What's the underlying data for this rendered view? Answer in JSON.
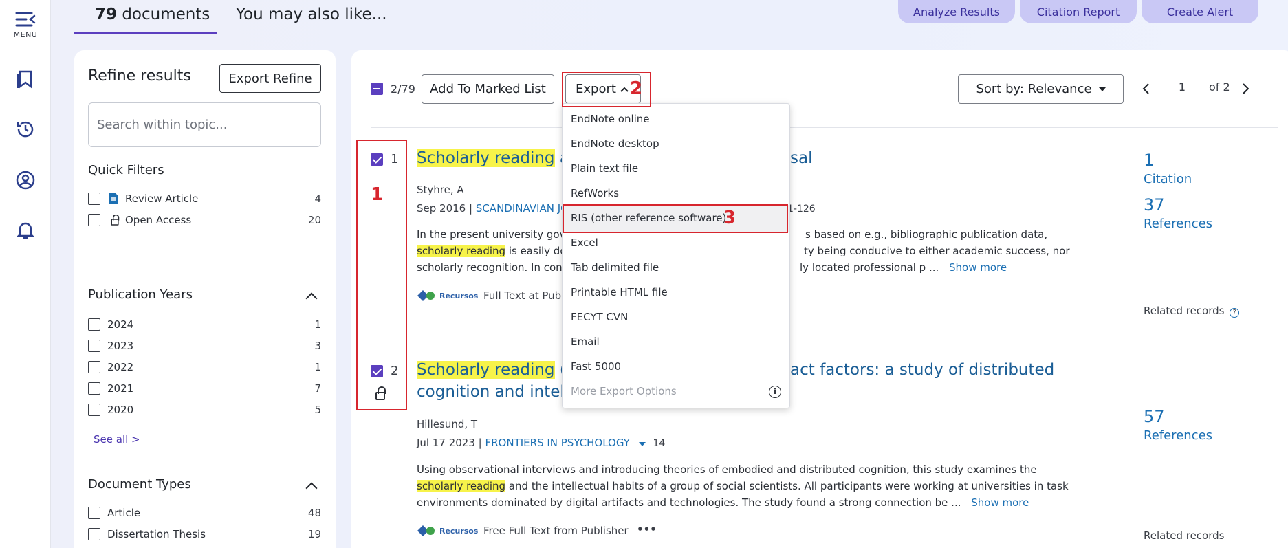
{
  "rail": {
    "menu_label": "MENU"
  },
  "tabs": {
    "count": "79",
    "documents": "documents",
    "also_like": "You may also like..."
  },
  "top_actions": {
    "analyze": "Analyze Results",
    "citation_report": "Citation Report",
    "create_alert": "Create Alert"
  },
  "refine": {
    "title": "Refine results",
    "export_button": "Export Refine",
    "search_placeholder": "Search within topic...",
    "quick_filters_title": "Quick Filters",
    "quick_filters": [
      {
        "label": "Review Article",
        "count": "4"
      },
      {
        "label": "Open Access",
        "count": "20"
      }
    ],
    "pub_years_title": "Publication Years",
    "pub_years": [
      {
        "label": "2024",
        "count": "1"
      },
      {
        "label": "2023",
        "count": "3"
      },
      {
        "label": "2022",
        "count": "1"
      },
      {
        "label": "2021",
        "count": "7"
      },
      {
        "label": "2020",
        "count": "5"
      }
    ],
    "see_all": "See all >",
    "doc_types_title": "Document Types",
    "doc_types": [
      {
        "label": "Article",
        "count": "48"
      },
      {
        "label": "Dissertation Thesis",
        "count": "19"
      }
    ]
  },
  "toolbar": {
    "selected": "2/79",
    "add_marked": "Add To Marked List",
    "export": "Export",
    "sort": "Sort by: Relevance",
    "page_value": "1",
    "page_of": "of 2"
  },
  "export_menu": [
    "EndNote online",
    "EndNote desktop",
    "Plain text file",
    "RefWorks",
    "RIS (other reference software)",
    "Excel",
    "Tab delimited file",
    "Printable HTML file",
    "FECYT CVN",
    "Email",
    "Fast 5000",
    "More Export Options"
  ],
  "results": [
    {
      "index": "1",
      "title_hl": "Scholarly reading",
      "title_rest": " as",
      "title_tail": "sal",
      "author": "Styhre, A",
      "date": "Sep 2016 | ",
      "journal": "SCANDINAVIAN JO",
      "pages": "1-126",
      "abs_l1a": "In the present university gover",
      "abs_l1b": "s based on e.g., bibliographic publication data,",
      "abs_l2hl": "scholarly reading",
      "abs_l2a": " is easily dow",
      "abs_l2b": "ty being conducive to either academic success, nor",
      "abs_l3a": "scholarly recognition. In contr",
      "abs_l3b": "ly located professional p ...",
      "show_more": "Show more",
      "fulltext": "Full Text at Publi",
      "recursos": "Recursos",
      "citations_num": "1",
      "citations_label": "Citation",
      "refs_num": "37",
      "refs_label": "References",
      "related": "Related records"
    },
    {
      "index": "2",
      "title_hl": "Scholarly reading",
      "title_rest": " (ar",
      "title_tail": "act factors: a study of distributed",
      "title_line2": "cognition and intelle",
      "author": "Hillesund, T",
      "date": "Jul 17 2023 | ",
      "journal": "FRONTIERS IN PSYCHOLOGY",
      "journal_count": "14",
      "abs_l1": "Using observational interviews and introducing theories of embodied and distributed cognition, this study examines the",
      "abs_l2hl": "scholarly reading",
      "abs_l2": " and the intellectual habits of a group of social scientists. All participants were working at universities in task",
      "abs_l3": "environments dominated by digital artifacts and technologies. The study found a strong connection be ...",
      "show_more": "Show more",
      "fulltext": "Free Full Text from Publisher",
      "recursos": "Recursos",
      "refs_num": "57",
      "refs_label": "References",
      "related": "Related records",
      "more_dots": "•••"
    }
  ],
  "annotations": {
    "n1": "1",
    "n2": "2",
    "n3": "3"
  }
}
